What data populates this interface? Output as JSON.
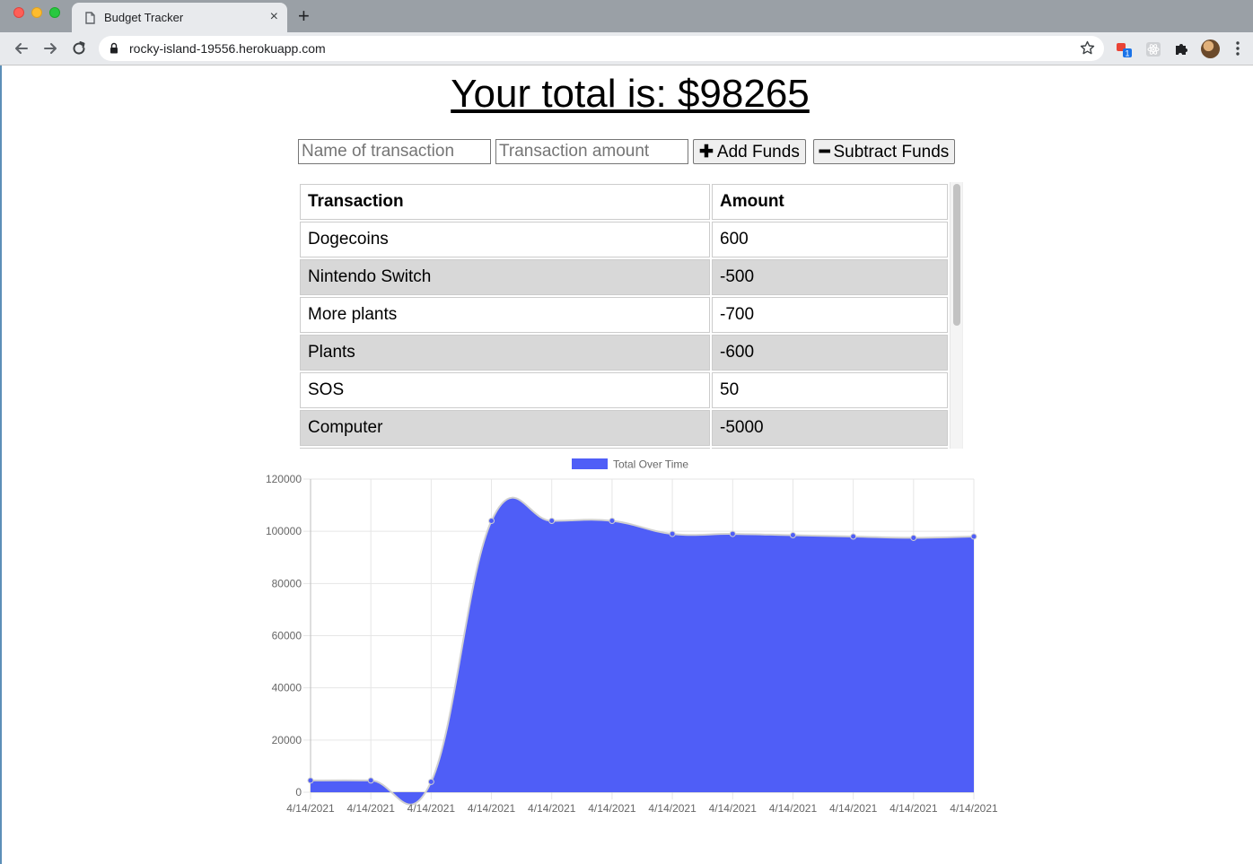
{
  "browser": {
    "tab_title": "Budget Tracker",
    "tab_close": "×",
    "new_tab": "+",
    "url": "rocky-island-19556.herokuapp.com",
    "extension_badge": "1"
  },
  "page": {
    "total_heading": "Your total is: $98265"
  },
  "form": {
    "name_placeholder": "Name of transaction",
    "amount_placeholder": "Transaction amount",
    "add_glyph": "✚",
    "add_label": "Add Funds",
    "subtract_glyph": "━",
    "subtract_label": "Subtract Funds"
  },
  "table": {
    "headers": [
      "Transaction",
      "Amount"
    ],
    "rows": [
      [
        "Dogecoins",
        "600"
      ],
      [
        "Nintendo Switch",
        "-500"
      ],
      [
        "More plants",
        "-700"
      ],
      [
        "Plants",
        "-600"
      ],
      [
        "SOS",
        "50"
      ],
      [
        "Computer",
        "-5000"
      ]
    ]
  },
  "colors": {
    "series_fill": "#4f5ef7",
    "series_line": "#d0d0d0",
    "grid": "#e6e6e6"
  },
  "chart_data": {
    "type": "area",
    "legend_position": "top",
    "grid": true,
    "categories": [
      "4/14/2021",
      "4/14/2021",
      "4/14/2021",
      "4/14/2021",
      "4/14/2021",
      "4/14/2021",
      "4/14/2021",
      "4/14/2021",
      "4/14/2021",
      "4/14/2021",
      "4/14/2021",
      "4/14/2021"
    ],
    "series": [
      {
        "name": "Total Over Time",
        "values": [
          4500,
          4500,
          4000,
          104000,
          104000,
          104000,
          99000,
          99000,
          98500,
          98000,
          97500,
          98000
        ]
      }
    ],
    "ylim": [
      0,
      120000
    ],
    "yticks": [
      0,
      20000,
      40000,
      60000,
      80000,
      100000,
      120000
    ]
  }
}
